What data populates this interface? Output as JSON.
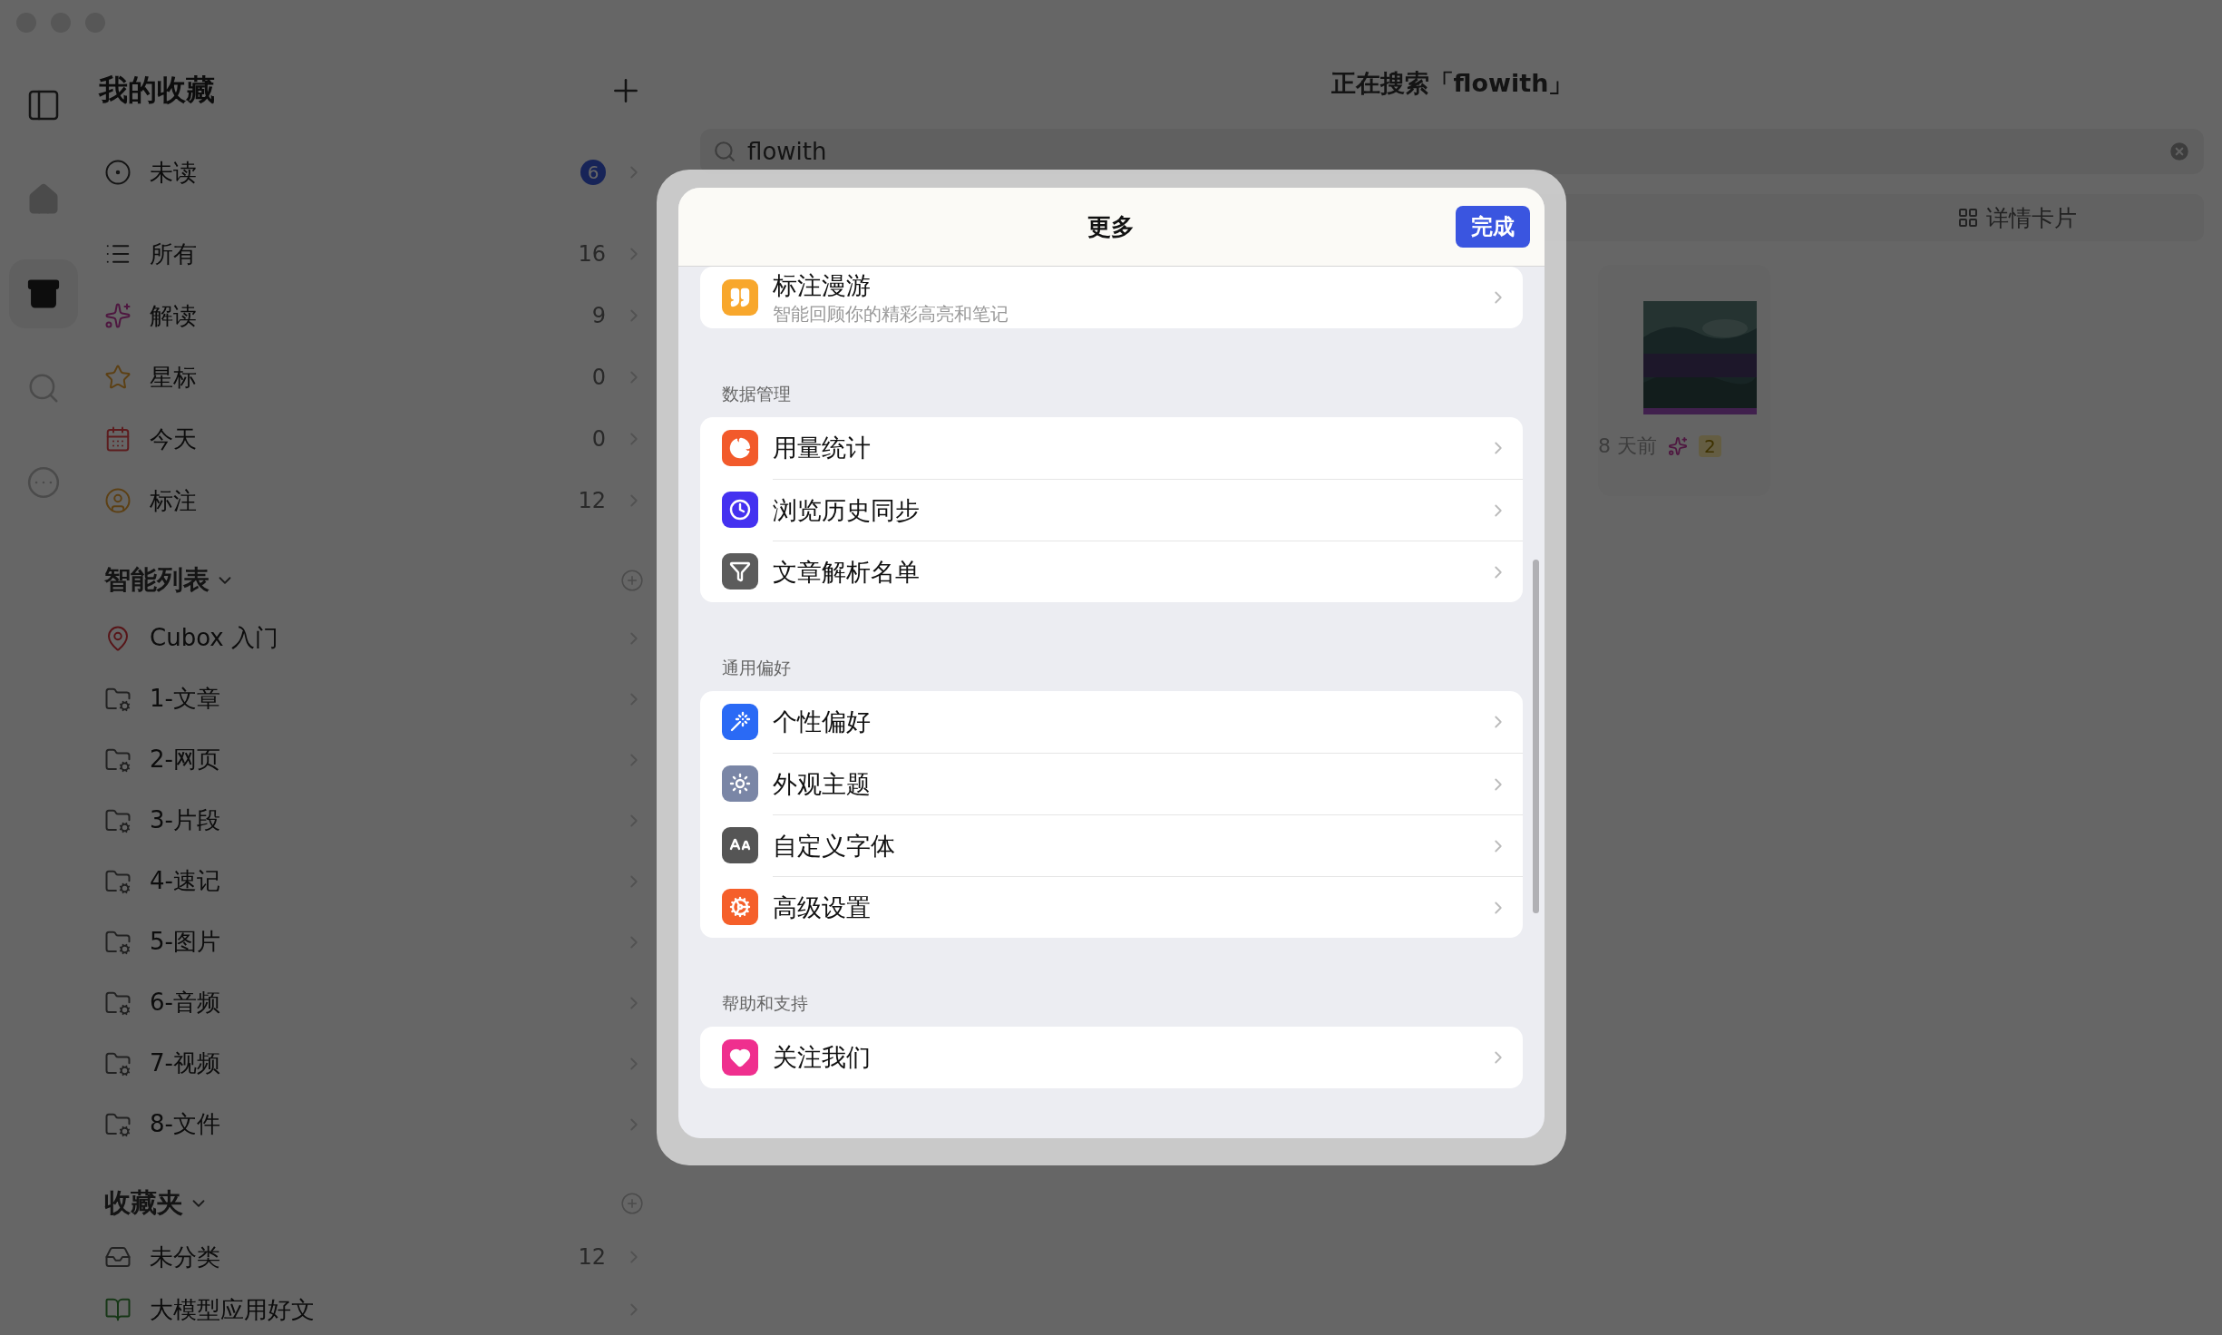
{
  "rail": [
    {
      "kind": "home",
      "selected": false
    },
    {
      "kind": "library",
      "selected": true
    },
    {
      "kind": "search",
      "selected": false
    },
    {
      "kind": "more",
      "selected": false
    }
  ],
  "sidebar": {
    "title": "我的收藏",
    "items": [
      {
        "kind": "unread",
        "label": "未读",
        "badge": "6"
      },
      {
        "kind": "list",
        "label": "所有",
        "count": "16"
      },
      {
        "kind": "sparkle",
        "label": "解读",
        "count": "9"
      },
      {
        "kind": "star",
        "label": "星标",
        "count": "0"
      },
      {
        "kind": "calendar",
        "label": "今天",
        "count": "0"
      },
      {
        "kind": "annotation",
        "label": "标注",
        "count": "12"
      }
    ],
    "smart_lists": {
      "title": "智能列表",
      "items": [
        {
          "kind": "pin",
          "label": "Cubox 入门"
        },
        {
          "kind": "folder",
          "label": "1-文章"
        },
        {
          "kind": "folder",
          "label": "2-网页"
        },
        {
          "kind": "folder",
          "label": "3-片段"
        },
        {
          "kind": "folder",
          "label": "4-速记"
        },
        {
          "kind": "folder",
          "label": "5-图片"
        },
        {
          "kind": "folder",
          "label": "6-音频"
        },
        {
          "kind": "folder",
          "label": "7-视频"
        },
        {
          "kind": "folder",
          "label": "8-文件"
        }
      ]
    },
    "folders": {
      "title": "收藏夹",
      "items": [
        {
          "kind": "inbox",
          "label": "未分类",
          "count": "12"
        },
        {
          "kind": "book",
          "label": "大模型应用好文"
        }
      ]
    }
  },
  "main": {
    "title": "正在搜索「flowith」",
    "search": {
      "value": "flowith"
    },
    "view_button": "详情卡片",
    "card": {
      "time": "8 天前",
      "badge": "2"
    }
  },
  "modal": {
    "title": "更多",
    "done": "完成",
    "sections": [
      {
        "items": [
          {
            "kind": "quote",
            "label": "标注漫游",
            "sublabel": "智能回顾你的精彩高亮和笔记",
            "color": "#f8a72c"
          }
        ]
      },
      {
        "title": "数据管理",
        "items": [
          {
            "kind": "pie",
            "label": "用量统计",
            "color": "#f25a2b"
          },
          {
            "kind": "clock",
            "label": "浏览历史同步",
            "color": "#4431f0"
          },
          {
            "kind": "filter",
            "label": "文章解析名单",
            "color": "#5c5c5c"
          }
        ]
      },
      {
        "title": "通用偏好",
        "items": [
          {
            "kind": "wand",
            "label": "个性偏好",
            "color": "#2a6af5"
          },
          {
            "kind": "sun",
            "label": "外观主题",
            "color": "#7a86a6"
          },
          {
            "kind": "font",
            "label": "自定义字体",
            "color": "#555555"
          },
          {
            "kind": "cog",
            "label": "高级设置",
            "color": "#f55f2a"
          }
        ]
      },
      {
        "title": "帮助和支持",
        "items": [
          {
            "kind": "heart",
            "label": "关注我们",
            "color": "#ef2f8e"
          }
        ]
      }
    ]
  }
}
